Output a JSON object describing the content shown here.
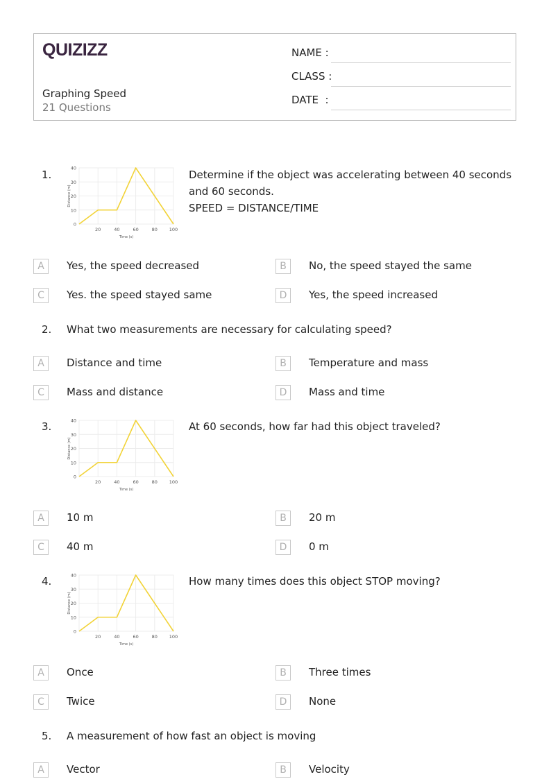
{
  "header": {
    "logo": "QUIZIZZ",
    "title": "Graphing Speed",
    "question_count": "21 Questions",
    "fields": [
      {
        "label": "NAME :"
      },
      {
        "label": "CLASS :"
      },
      {
        "label": "DATE  :"
      }
    ]
  },
  "questions": [
    {
      "number": "1.",
      "text_lines": [
        "Determine if the object was accelerating between 40 seconds",
        "and 60 seconds.",
        "SPEED = DISTANCE/TIME"
      ],
      "has_graph": true,
      "options": [
        {
          "letter": "A",
          "text": "Yes, the speed decreased"
        },
        {
          "letter": "B",
          "text": "No, the speed stayed the same"
        },
        {
          "letter": "C",
          "text": "Yes. the speed stayed same"
        },
        {
          "letter": "D",
          "text": "Yes, the speed increased"
        }
      ]
    },
    {
      "number": "2.",
      "text_lines": [
        "What two measurements are necessary for calculating speed?"
      ],
      "has_graph": false,
      "options": [
        {
          "letter": "A",
          "text": "Distance and time"
        },
        {
          "letter": "B",
          "text": "Temperature and mass"
        },
        {
          "letter": "C",
          "text": "Mass and distance"
        },
        {
          "letter": "D",
          "text": "Mass and time"
        }
      ]
    },
    {
      "number": "3.",
      "text_lines": [
        "At 60 seconds, how far had this object traveled?"
      ],
      "has_graph": true,
      "options": [
        {
          "letter": "A",
          "text": "10 m"
        },
        {
          "letter": "B",
          "text": "20 m"
        },
        {
          "letter": "C",
          "text": "40 m"
        },
        {
          "letter": "D",
          "text": "0 m"
        }
      ]
    },
    {
      "number": "4.",
      "text_lines": [
        "How many times does this object STOP moving?"
      ],
      "has_graph": true,
      "options": [
        {
          "letter": "A",
          "text": "Once"
        },
        {
          "letter": "B",
          "text": "Three times"
        },
        {
          "letter": "C",
          "text": "Twice"
        },
        {
          "letter": "D",
          "text": "None"
        }
      ]
    },
    {
      "number": "5.",
      "text_lines": [
        "A measurement of how fast an object is moving"
      ],
      "has_graph": false,
      "options": [
        {
          "letter": "A",
          "text": "Vector"
        },
        {
          "letter": "B",
          "text": "Velocity"
        }
      ]
    }
  ],
  "chart_data": {
    "type": "line",
    "title": "",
    "xlabel": "Time (s)",
    "ylabel": "Distance (m)",
    "x": [
      0,
      20,
      40,
      60,
      100
    ],
    "series": [
      {
        "name": "distance",
        "values": [
          0,
          10,
          10,
          40,
          0
        ],
        "color": "#f2d338"
      }
    ],
    "xlim": [
      0,
      100
    ],
    "ylim": [
      0,
      40
    ],
    "xticks": [
      20,
      40,
      60,
      80,
      100
    ],
    "yticks": [
      0,
      10,
      20,
      30,
      40
    ],
    "grid": true,
    "legend": "none"
  }
}
